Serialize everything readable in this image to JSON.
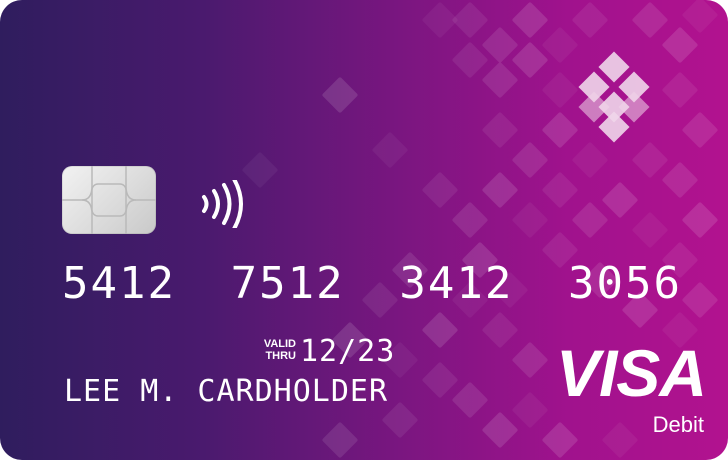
{
  "card": {
    "number_groups": [
      "5412",
      "7512",
      "3412",
      "3056"
    ],
    "valid_label_line1": "VALID",
    "valid_label_line2": "THRU",
    "expiry": "12/23",
    "cardholder": "LEE M. CARDHOLDER",
    "network": "VISA",
    "card_type": "Debit"
  },
  "icons": {
    "chip": "emv-chip-icon",
    "contactless": "contactless-icon",
    "logo": "diamond-logo-icon"
  },
  "colors": {
    "gradient_start": "#2f1d5e",
    "gradient_end": "#b2128f",
    "text": "#ffffff"
  }
}
